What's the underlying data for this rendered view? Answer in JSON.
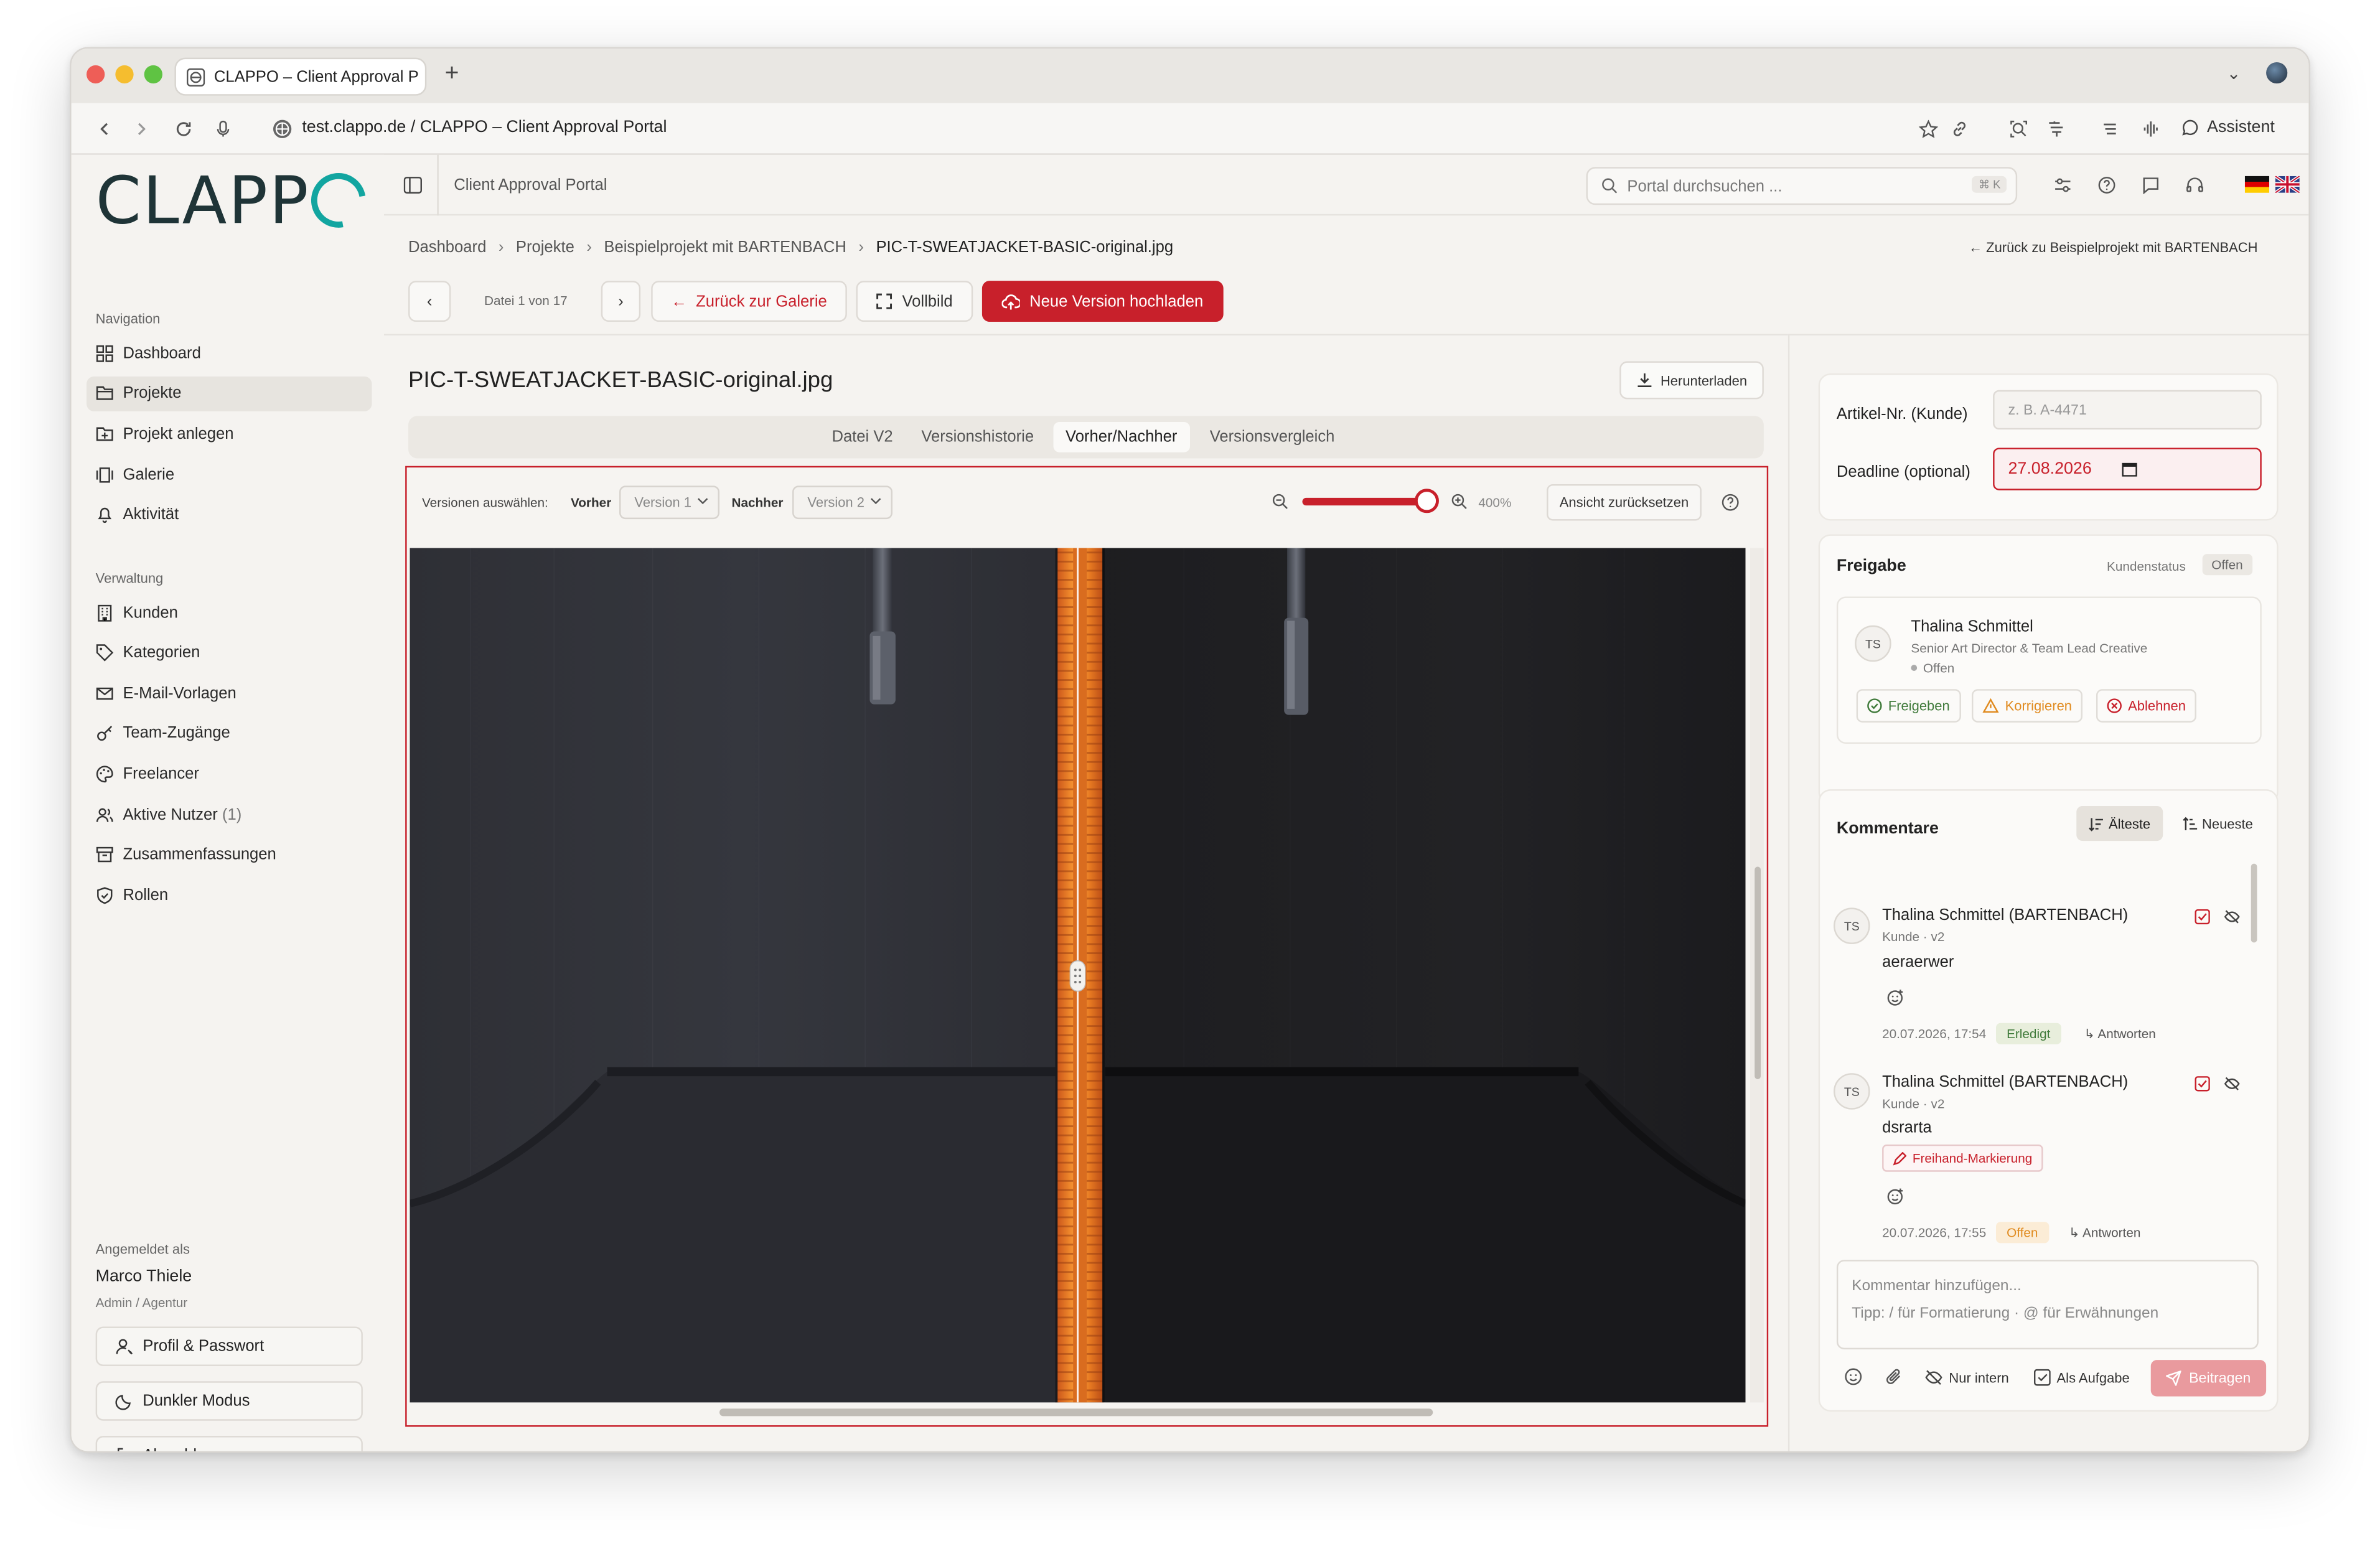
{
  "browser": {
    "tab_title": "CLAPPO – Client Approval P",
    "url_host": "test.clappo.de",
    "url_sep": "/",
    "url_page": "CLAPPO – Client Approval Portal",
    "assistant_label": "Assistent"
  },
  "sidebar": {
    "logo": "CLAPP",
    "nav_title": "Navigation",
    "nav_items": [
      {
        "label": "Dashboard",
        "icon": "dashboard-icon"
      },
      {
        "label": "Projekte",
        "icon": "folder-icon",
        "active": true
      },
      {
        "label": "Projekt anlegen",
        "icon": "folder-plus-icon"
      },
      {
        "label": "Galerie",
        "icon": "gallery-icon"
      },
      {
        "label": "Aktivität",
        "icon": "bell-icon"
      }
    ],
    "admin_title": "Verwaltung",
    "admin_items": [
      {
        "label": "Kunden",
        "icon": "building-icon"
      },
      {
        "label": "Kategorien",
        "icon": "tag-icon"
      },
      {
        "label": "E-Mail-Vorlagen",
        "icon": "mail-icon"
      },
      {
        "label": "Team-Zugänge",
        "icon": "key-icon"
      },
      {
        "label": "Freelancer",
        "icon": "palette-icon"
      },
      {
        "label": "Aktive Nutzer",
        "count": "(1)",
        "icon": "users-icon"
      },
      {
        "label": "Zusammenfassungen",
        "icon": "archive-icon"
      },
      {
        "label": "Rollen",
        "icon": "shield-icon"
      }
    ],
    "logged_in_label": "Angemeldet als",
    "user_name": "Marco Thiele",
    "user_role": "Admin / Agentur",
    "profile_button": "Profil & Passwort",
    "dark_mode_button": "Dunkler Modus",
    "logout_button": "Abmelden"
  },
  "topbar": {
    "title": "Client Approval Portal",
    "search_placeholder": "Portal durchsuchen ...",
    "search_shortcut": "⌘ K"
  },
  "breadcrumb": {
    "items": [
      "Dashboard",
      "Projekte",
      "Beispielprojekt mit BARTENBACH",
      "PIC-T-SWEATJACKET-BASIC-original.jpg"
    ],
    "back_link": "Zurück zu Beispielprojekt mit BARTENBACH"
  },
  "toolbar": {
    "file_counter": "Datei 1 von 17",
    "back_gallery": "Zurück zur Galerie",
    "fullscreen": "Vollbild",
    "upload": "Neue Version hochladen"
  },
  "file": {
    "title": "PIC-T-SWEATJACKET-BASIC-original.jpg",
    "download": "Herunterladen"
  },
  "view_tabs": [
    "Datei V2",
    "Versionshistorie",
    "Vorher/Nachher",
    "Versionsvergleich"
  ],
  "active_view_tab": "Vorher/Nachher",
  "compare": {
    "select_label": "Versionen auswählen:",
    "before_label": "Vorher",
    "before_value": "Version 1",
    "after_label": "Nachher",
    "after_value": "Version 2",
    "zoom": "400%",
    "zoom_fraction": 0.95,
    "reset_view": "Ansicht zurücksetzen",
    "divider_position": 0.5
  },
  "details": {
    "article_label": "Artikel-Nr. (Kunde)",
    "article_placeholder": "z. B. A-4471",
    "deadline_label": "Deadline (optional)",
    "deadline_value": "27.08.2026"
  },
  "approval": {
    "title": "Freigabe",
    "client_status_label": "Kundenstatus",
    "client_status": "Offen",
    "person_initials": "TS",
    "person_name": "Thalina Schmittel",
    "person_role": "Senior Art Director & Team Lead Creative",
    "person_status": "Offen",
    "approve": "Freigeben",
    "correct": "Korrigieren",
    "reject": "Ablehnen"
  },
  "comments": {
    "title": "Kommentare",
    "sort_oldest": "Älteste",
    "sort_newest": "Neueste",
    "items": [
      {
        "initials": "TS",
        "author": "Thalina Schmittel (BARTENBACH)",
        "role": "Kunde · v2",
        "text": "aeraerwer",
        "time": "20.07.2026, 17:54",
        "status": "Erledigt",
        "reply": "Antworten"
      },
      {
        "initials": "TS",
        "author": "Thalina Schmittel (BARTENBACH)",
        "role": "Kunde · v2",
        "text": "dsrarta",
        "tag": "Freihand-Markierung",
        "time": "20.07.2026, 17:55",
        "status": "Offen",
        "reply": "Antworten"
      }
    ],
    "input_placeholder": "Kommentar hinzufügen...",
    "input_hint": "Tipp: / für Formatierung · @ für Erwähnungen",
    "internal_only": "Nur intern",
    "as_task": "Als Aufgabe",
    "submit": "Beitragen"
  },
  "colors": {
    "accent": "#c8202b",
    "logo_dark": "#1f3437",
    "logo_teal": "#12a5a0",
    "done_green": "#3f7a3a",
    "open_orange": "#e08a1e"
  }
}
